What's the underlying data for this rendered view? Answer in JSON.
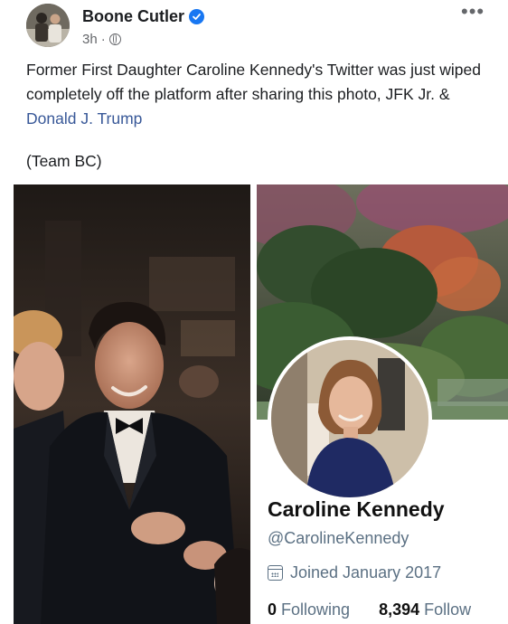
{
  "post": {
    "author": "Boone Cutler",
    "time": "3h",
    "separator": "·",
    "more_label": "•••",
    "text_before": "Former First Daughter Caroline Kennedy's Twitter was just wiped completely off the platform after sharing this photo, JFK Jr. & ",
    "mention": "Donald J. Trump",
    "signature": "(Team BC)"
  },
  "profile_card": {
    "name": "Caroline Kennedy",
    "handle": "@CarolineKennedy",
    "joined": "Joined January 2017",
    "following_count": "0",
    "following_label": "Following",
    "followers_count": "8,394",
    "followers_label": "Follow"
  },
  "icons": {
    "verified": "verified-badge-icon",
    "audience": "globe-icon",
    "more": "more-options-icon",
    "calendar": "calendar-icon"
  },
  "colors": {
    "link": "#385898",
    "verified": "#1877f2",
    "muted": "#65676b",
    "twitter_muted": "#5b7083"
  }
}
